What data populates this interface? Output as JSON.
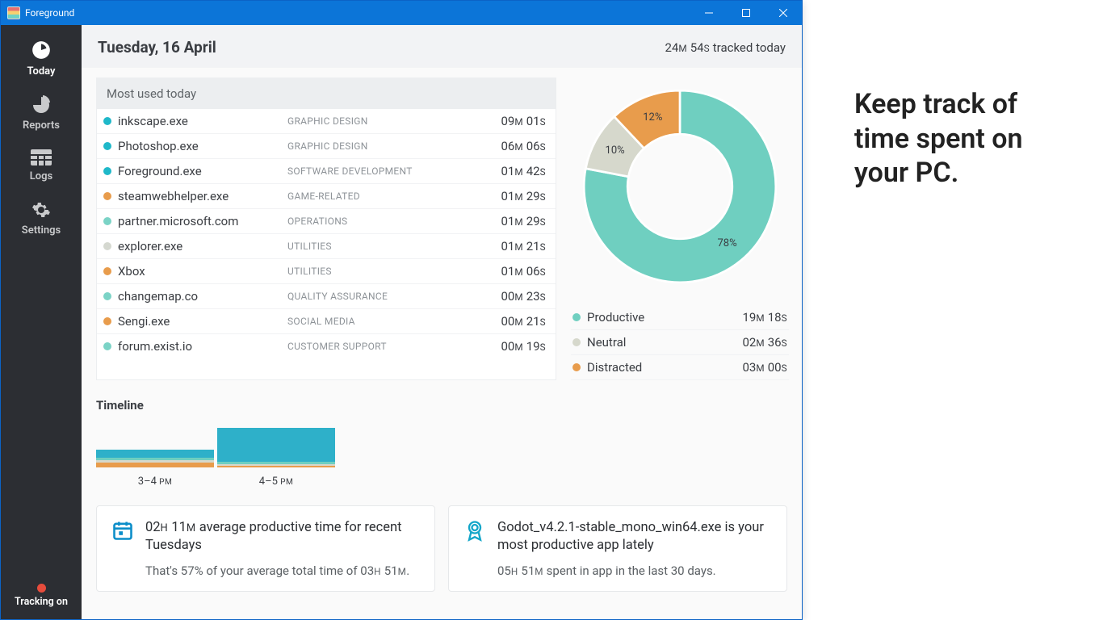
{
  "window": {
    "title": "Foreground"
  },
  "sidebar": {
    "items": [
      {
        "label": "Today",
        "icon": "clock"
      },
      {
        "label": "Reports",
        "icon": "pie"
      },
      {
        "label": "Logs",
        "icon": "table"
      },
      {
        "label": "Settings",
        "icon": "gear"
      }
    ],
    "status_label": "Tracking on"
  },
  "header": {
    "date": "Tuesday, 16 April",
    "tracked_value": "24",
    "tracked_unit1": "M",
    "tracked_value2": "54",
    "tracked_unit2": "S",
    "tracked_suffix": " tracked today"
  },
  "most_used": {
    "title": "Most used today",
    "rows": [
      {
        "color": "#1fb8c9",
        "name": "inkscape.exe",
        "category": "GRAPHIC DESIGN",
        "m": "09",
        "s": "01"
      },
      {
        "color": "#1fb8c9",
        "name": "Photoshop.exe",
        "category": "GRAPHIC DESIGN",
        "m": "06",
        "s": "06"
      },
      {
        "color": "#1fb8c9",
        "name": "Foreground.exe",
        "category": "SOFTWARE DEVELOPMENT",
        "m": "01",
        "s": "42"
      },
      {
        "color": "#e89c4c",
        "name": "steamwebhelper.exe",
        "category": "GAME-RELATED",
        "m": "01",
        "s": "29"
      },
      {
        "color": "#7bd3c6",
        "name": "partner.microsoft.com",
        "category": "OPERATIONS",
        "m": "01",
        "s": "29"
      },
      {
        "color": "#d5d8d0",
        "name": "explorer.exe",
        "category": "UTILITIES",
        "m": "01",
        "s": "21"
      },
      {
        "color": "#e89c4c",
        "name": "Xbox",
        "category": "UTILITIES",
        "m": "01",
        "s": "06"
      },
      {
        "color": "#7bd3c6",
        "name": "changemap.co",
        "category": "QUALITY ASSURANCE",
        "m": "00",
        "s": "23"
      },
      {
        "color": "#e89c4c",
        "name": "Sengi.exe",
        "category": "SOCIAL MEDIA",
        "m": "00",
        "s": "21"
      },
      {
        "color": "#7bd3c6",
        "name": "forum.exist.io",
        "category": "CUSTOMER SUPPORT",
        "m": "00",
        "s": "19"
      }
    ]
  },
  "chart_data": {
    "type": "pie",
    "title": "",
    "series": [
      {
        "name": "Productive",
        "value": 78,
        "color": "#6fcfc0",
        "time_m": "19",
        "time_s": "18"
      },
      {
        "name": "Neutral",
        "value": 10,
        "color": "#d6d8cc",
        "time_m": "02",
        "time_s": "36"
      },
      {
        "name": "Distracted",
        "value": 12,
        "color": "#e89c4c",
        "time_m": "03",
        "time_s": "00"
      }
    ]
  },
  "timeline": {
    "title": "Timeline",
    "bars": [
      {
        "label": "3–4 PM",
        "segments": [
          {
            "color": "#2eb0c9",
            "h": 10
          },
          {
            "color": "#6fcfc0",
            "h": 3
          },
          {
            "color": "#d6d8cc",
            "h": 3
          },
          {
            "color": "#e89c4c",
            "h": 6
          }
        ]
      },
      {
        "label": "4–5 PM",
        "segments": [
          {
            "color": "#2eb0c9",
            "h": 42
          },
          {
            "color": "#6fcfc0",
            "h": 3
          },
          {
            "color": "#d6d8cc",
            "h": 2
          },
          {
            "color": "#e89c4c",
            "h": 2
          }
        ]
      }
    ]
  },
  "cards": [
    {
      "icon": "calendar",
      "title_parts": [
        "02",
        "H",
        " 11",
        "M",
        " average productive time for recent Tuesdays"
      ],
      "body_parts": [
        "That's 57% of your average total time of 03",
        "H",
        " 51",
        "M",
        "."
      ]
    },
    {
      "icon": "award",
      "title_parts": [
        "Godot_v4.2.1-stable_mono_win64.exe is your most productive app lately"
      ],
      "body_parts": [
        "05",
        "H",
        " 51",
        "M",
        " spent in app in the last 30 days."
      ]
    }
  ],
  "promo": {
    "headline": "Keep track of time spent on your PC."
  }
}
